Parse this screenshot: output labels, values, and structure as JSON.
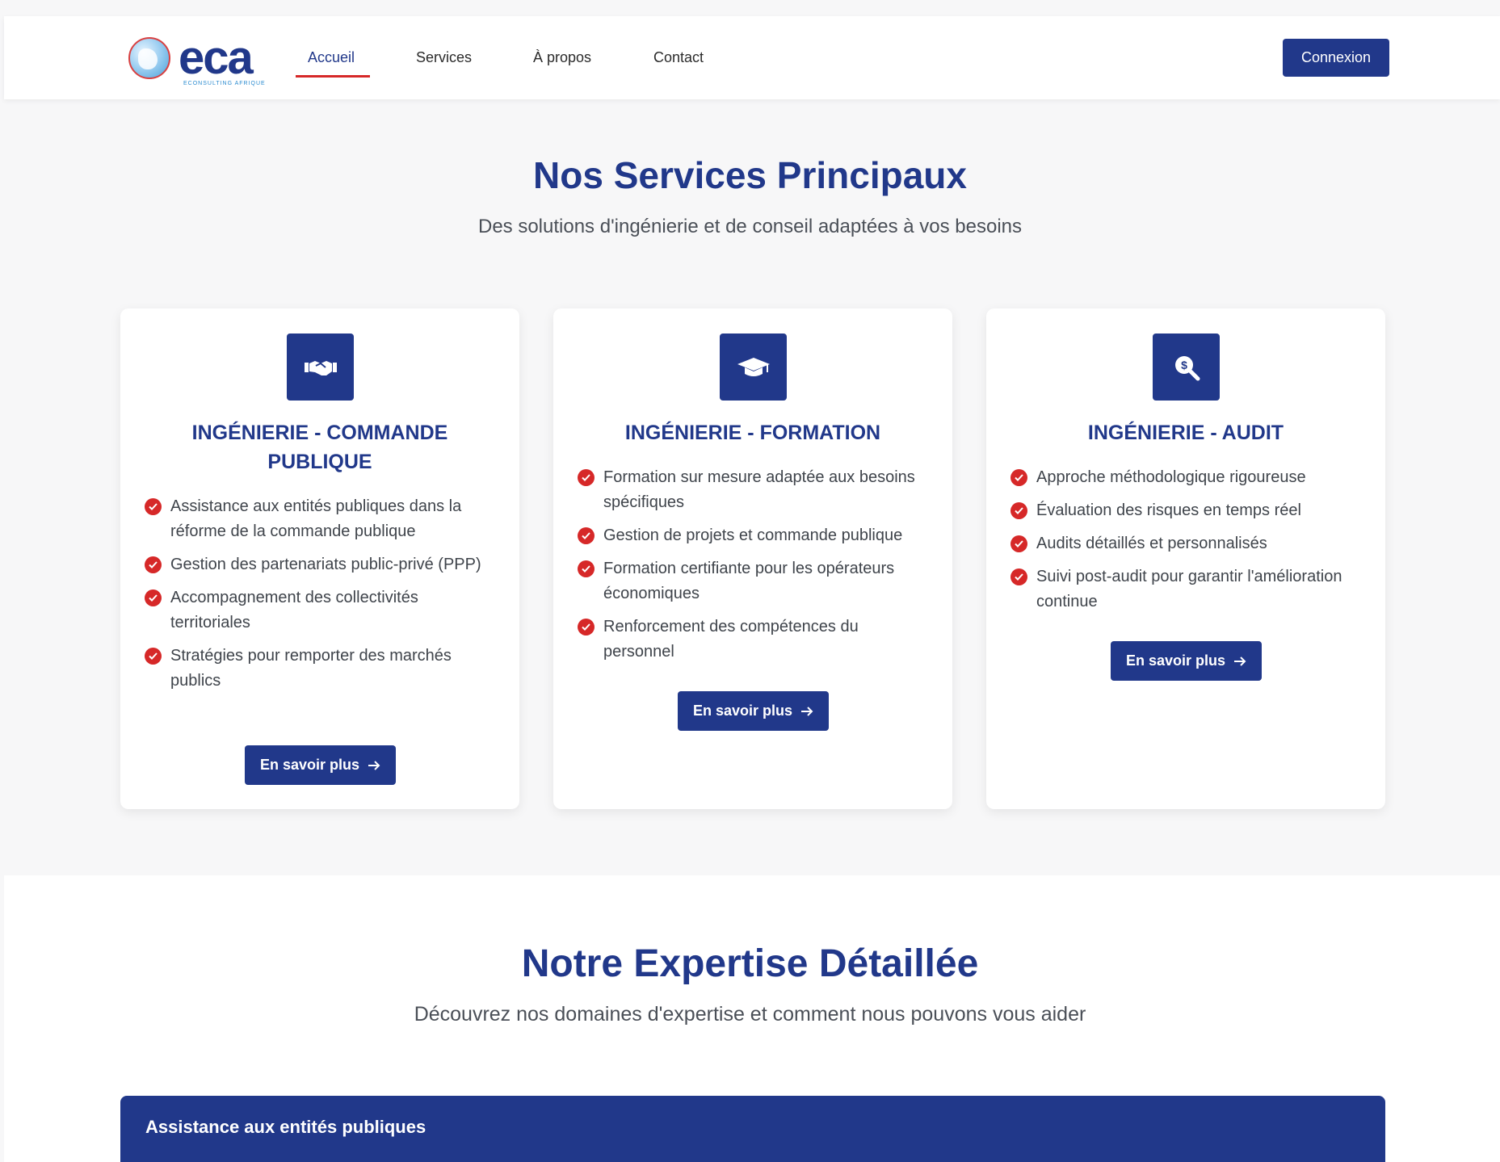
{
  "header": {
    "logo": {
      "wordmark": "eca",
      "tagline": "ECONSULTING AFRIQUE"
    },
    "nav": [
      {
        "label": "Accueil",
        "active": true
      },
      {
        "label": "Services",
        "active": false
      },
      {
        "label": "À propos",
        "active": false
      },
      {
        "label": "Contact",
        "active": false
      }
    ],
    "login_label": "Connexion"
  },
  "services": {
    "title": "Nos Services Principaux",
    "subtitle": "Des solutions d'ingénierie et de conseil adaptées à vos besoins",
    "cards": [
      {
        "icon": "handshake-icon",
        "title": "INGÉNIERIE - COMMANDE PUBLIQUE",
        "items": [
          "Assistance aux entités publiques dans la réforme de la commande publique",
          "Gestion des partenariats public-privé (PPP)",
          "Accompagnement des collectivités territoriales",
          "Stratégies pour remporter des marchés publics"
        ],
        "button": "En savoir plus"
      },
      {
        "icon": "graduation-cap-icon",
        "title": "INGÉNIERIE - FORMATION",
        "items": [
          "Formation sur mesure adaptée aux besoins spécifiques",
          "Gestion de projets et commande publique",
          "Formation certifiante pour les opérateurs économiques",
          "Renforcement des compétences du personnel"
        ],
        "button": "En savoir plus"
      },
      {
        "icon": "search-dollar-icon",
        "title": "INGÉNIERIE - AUDIT",
        "items": [
          "Approche méthodologique rigoureuse",
          "Évaluation des risques en temps réel",
          "Audits détaillés et personnalisés",
          "Suivi post-audit pour garantir l'amélioration continue"
        ],
        "button": "En savoir plus"
      }
    ]
  },
  "expertise": {
    "title": "Notre Expertise Détaillée",
    "subtitle": "Découvrez nos domaines d'expertise et comment nous pouvons vous aider",
    "accordion_first": "Assistance aux entités publiques"
  },
  "colors": {
    "brand_blue": "#21388a",
    "accent_red": "#d62828"
  }
}
